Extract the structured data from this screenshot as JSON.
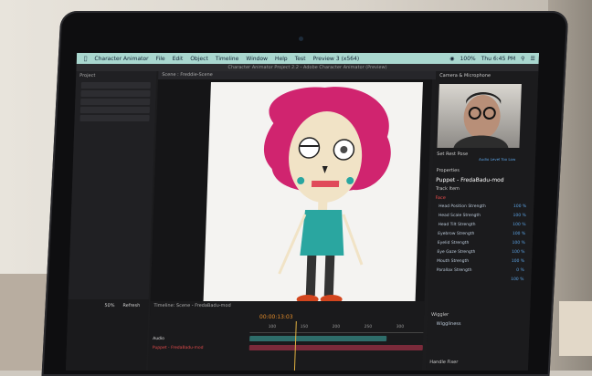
{
  "menubar": {
    "app": "Character Animator",
    "items": [
      "File",
      "Edit",
      "Object",
      "Timeline",
      "Window",
      "Help",
      "Test",
      "Preview 3 (x564)"
    ],
    "battery": "100%",
    "clock": "Thu 6:45 PM"
  },
  "titlebar": "Character Animator Project 2.2 - Adobe Character Animator (Preview)",
  "left_panel": {
    "header": "Project"
  },
  "scene": {
    "tab": "Scene : Freddie-Scene",
    "zoom": "50%",
    "refresh": "Refresh"
  },
  "right_panel": {
    "camera_header": "Camera & Microphone",
    "set_rest_pose": "Set Rest Pose",
    "audio_level": "Audio Level Too Low",
    "properties_header": "Properties",
    "puppet_name": "Puppet - FredaBadu-mod",
    "track_item": "Track Item",
    "face_section": "Face",
    "face_props": [
      {
        "label": "Head Position Strength",
        "value": "100 %"
      },
      {
        "label": "Head Scale Strength",
        "value": "100 %"
      },
      {
        "label": "Head Tilt Strength",
        "value": "100 %"
      },
      {
        "label": "Eyebrow Strength",
        "value": "100 %"
      },
      {
        "label": "Eyelid Strength",
        "value": "100 %"
      },
      {
        "label": "Eye Gaze Strength",
        "value": "100 %"
      },
      {
        "label": "Mouth Strength",
        "value": "100 %"
      },
      {
        "label": "Parallax Strength",
        "value": "0 %"
      },
      {
        "label": "",
        "value": "100 %"
      }
    ],
    "wiggler_section": "Wiggler",
    "wiggler_prop": "Wiggliness",
    "handle_fixer": "Handle Fixer"
  },
  "timeline": {
    "header": "Timeline: Scene - FredaBadu-mod",
    "timecode": "00:00:13:03",
    "ruler": [
      "100",
      "150",
      "200",
      "250",
      "300"
    ],
    "tracks": [
      "Audio",
      "Puppet - FredaBadu-mod"
    ],
    "clip": "audio-clip (1).aiff.wav"
  },
  "colors": {
    "menubar": "#a9d7cf",
    "accent_orange": "#e08a2a",
    "value_blue": "#5aa0e0",
    "afro": "#d0246f"
  }
}
